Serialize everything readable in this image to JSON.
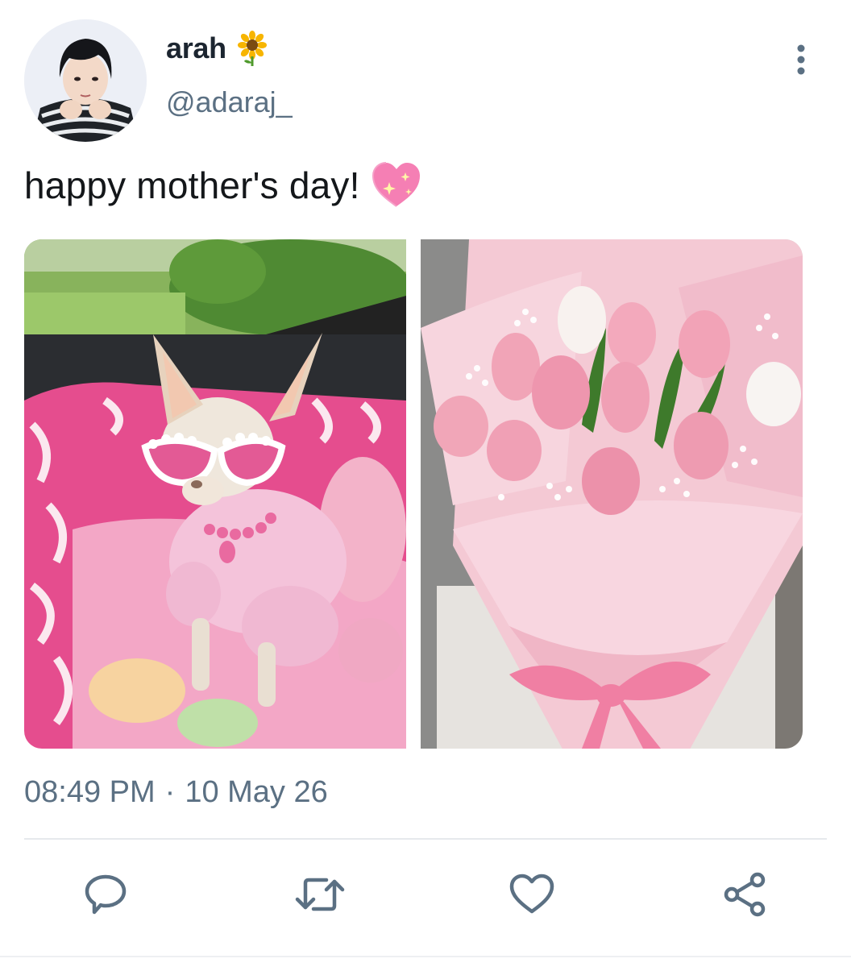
{
  "author": {
    "display_name": "arah",
    "handle": "@adaraj_",
    "name_emoji": "sunflower-icon",
    "avatar": "avatar"
  },
  "tweet": {
    "text": "happy mother's day!",
    "text_emoji": "sparkling-heart-icon",
    "timestamp_time": "08:49 PM",
    "timestamp_separator": "·",
    "timestamp_date": "10 May 26"
  },
  "media": [
    {
      "name": "chihuahua-photo"
    },
    {
      "name": "tulip-bouquet-photo"
    }
  ],
  "actions": [
    {
      "name": "reply-icon"
    },
    {
      "name": "retweet-icon"
    },
    {
      "name": "like-icon"
    },
    {
      "name": "share-icon"
    }
  ],
  "colors": {
    "text": "#14171a",
    "secondary": "#5b7083",
    "divider": "#e6e9ec"
  }
}
